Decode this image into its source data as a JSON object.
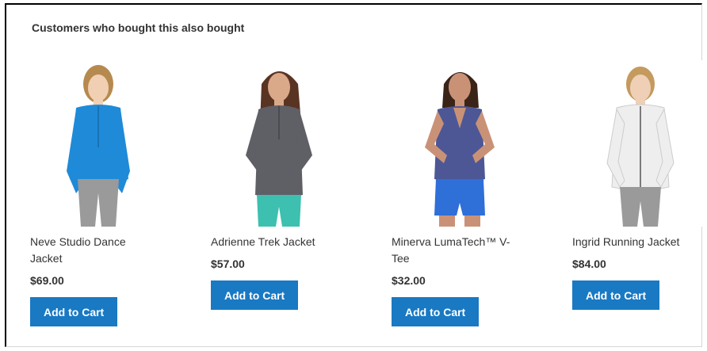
{
  "block": {
    "title": "Customers who bought this also bought"
  },
  "products": [
    {
      "name": "Neve Studio Dance Jacket",
      "price": "$69.00",
      "button": "Add to Cart",
      "shirt_color": "#1f8ad8",
      "pants_color": "#9a9a9a",
      "hair_color": "#b68a4e"
    },
    {
      "name": "Adrienne Trek Jacket",
      "price": "$57.00",
      "button": "Add to Cart",
      "shirt_color": "#5f5f66",
      "pants_color": "#3dc0b0",
      "hair_color": "#5a3422"
    },
    {
      "name": "Minerva LumaTech™ V-Tee",
      "price": "$32.00",
      "button": "Add to Cart",
      "shirt_color": "#4d5796",
      "pants_color": "#2e6fd8",
      "hair_color": "#3a2418"
    },
    {
      "name": "Ingrid Running Jacket",
      "price": "$84.00",
      "button": "Add to Cart",
      "shirt_color": "#eeeeee",
      "pants_color": "#9a9a9a",
      "hair_color": "#c49a5e"
    }
  ]
}
